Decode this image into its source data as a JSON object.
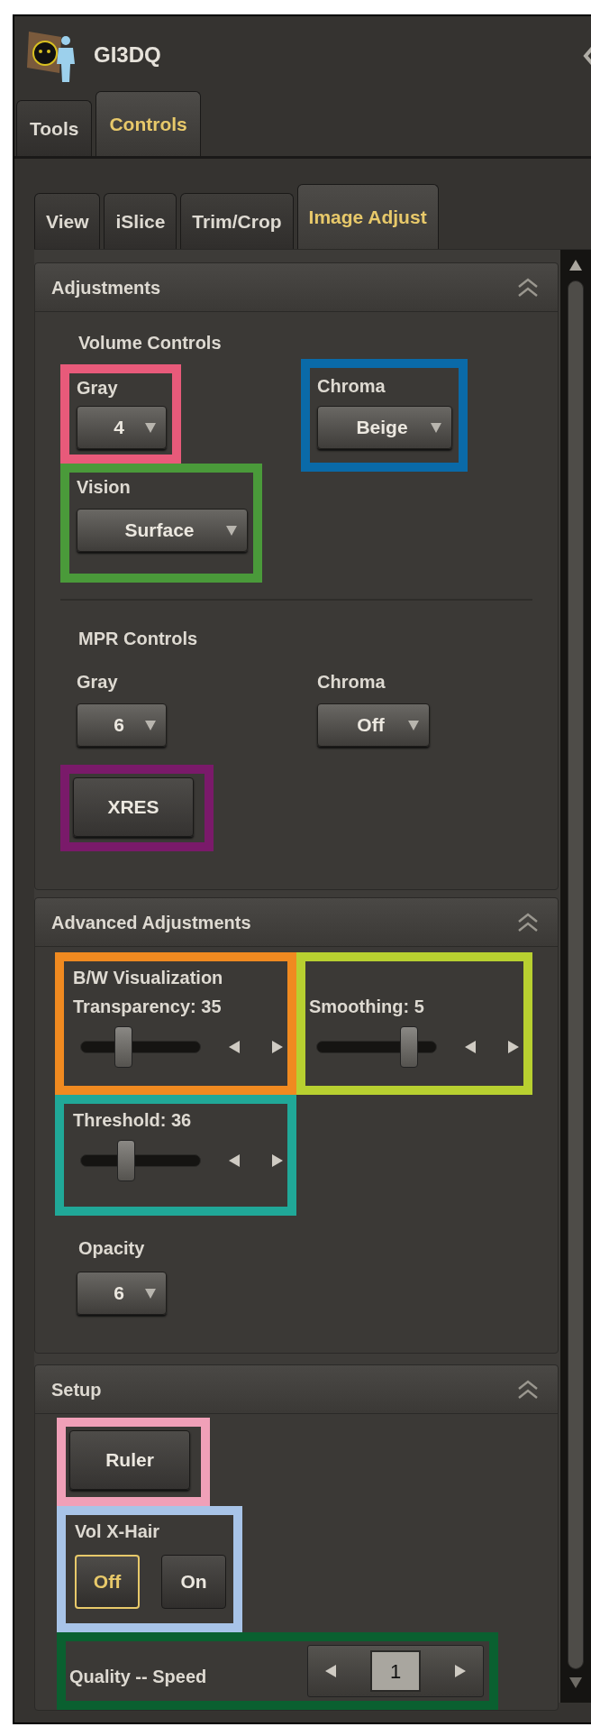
{
  "window": {
    "title": "GI3DQ"
  },
  "main_tabs": [
    {
      "label": "Tools",
      "selected": false
    },
    {
      "label": "Controls",
      "selected": true
    }
  ],
  "sub_tabs": [
    {
      "label": "View",
      "selected": false
    },
    {
      "label": "iSlice",
      "selected": false
    },
    {
      "label": "Trim/Crop",
      "selected": false
    },
    {
      "label": "Image Adjust",
      "selected": true
    }
  ],
  "adjustments": {
    "title": "Adjustments",
    "expanded": true,
    "volume_controls": {
      "heading": "Volume Controls",
      "gray": {
        "label": "Gray",
        "value": "4",
        "color": "#e85a7a"
      },
      "chroma": {
        "label": "Chroma",
        "value": "Beige",
        "color": "#0a6aa8"
      },
      "vision": {
        "label": "Vision",
        "value": "Surface",
        "color": "#4a9a3a"
      }
    },
    "mpr_controls": {
      "heading": "MPR Controls",
      "gray": {
        "label": "Gray",
        "value": "6"
      },
      "chroma": {
        "label": "Chroma",
        "value": "Off"
      }
    },
    "xres": {
      "label": "XRES",
      "color": "#7a1a6a"
    }
  },
  "advanced": {
    "title": "Advanced Adjustments",
    "expanded": true,
    "bw": {
      "heading": "B/W Visualization",
      "label": "Transparency: 35",
      "level": 0.36,
      "color": "#f08a20"
    },
    "smoothing": {
      "label": "Smoothing: 5",
      "level": 0.77,
      "color": "#b8d030"
    },
    "threshold": {
      "label": "Threshold: 36",
      "level": 0.38,
      "color": "#20a898"
    },
    "opacity": {
      "label": "Opacity",
      "value": "6"
    }
  },
  "setup": {
    "title": "Setup",
    "expanded": true,
    "ruler": {
      "label": "Ruler",
      "color": "#f0a0b8"
    },
    "crosshair": {
      "label": "Vol X-Hair",
      "color": "#a8c4e8",
      "options": [
        {
          "label": "Off",
          "selected": true
        },
        {
          "label": "On",
          "selected": false
        }
      ]
    },
    "quality": {
      "label": "Quality -- Speed",
      "value": "1",
      "color": "#0a6030"
    }
  }
}
